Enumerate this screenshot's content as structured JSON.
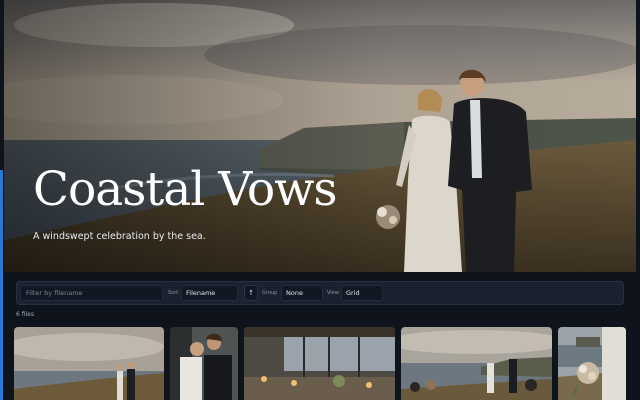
{
  "hero": {
    "title": "Coastal Vows",
    "subtitle": "A windswept celebration by the sea."
  },
  "filters": {
    "search_placeholder": "Filter by filename",
    "sort_label": "Sort",
    "sort_value": "Filename",
    "sort_direction": "↑",
    "group_label": "Group",
    "group_value": "None",
    "view_label": "View",
    "view_value": "Grid"
  },
  "file_count": "6 files",
  "colors": {
    "background": "#0f141c",
    "panel": "#1a2230",
    "accent": "#2a78d6"
  }
}
